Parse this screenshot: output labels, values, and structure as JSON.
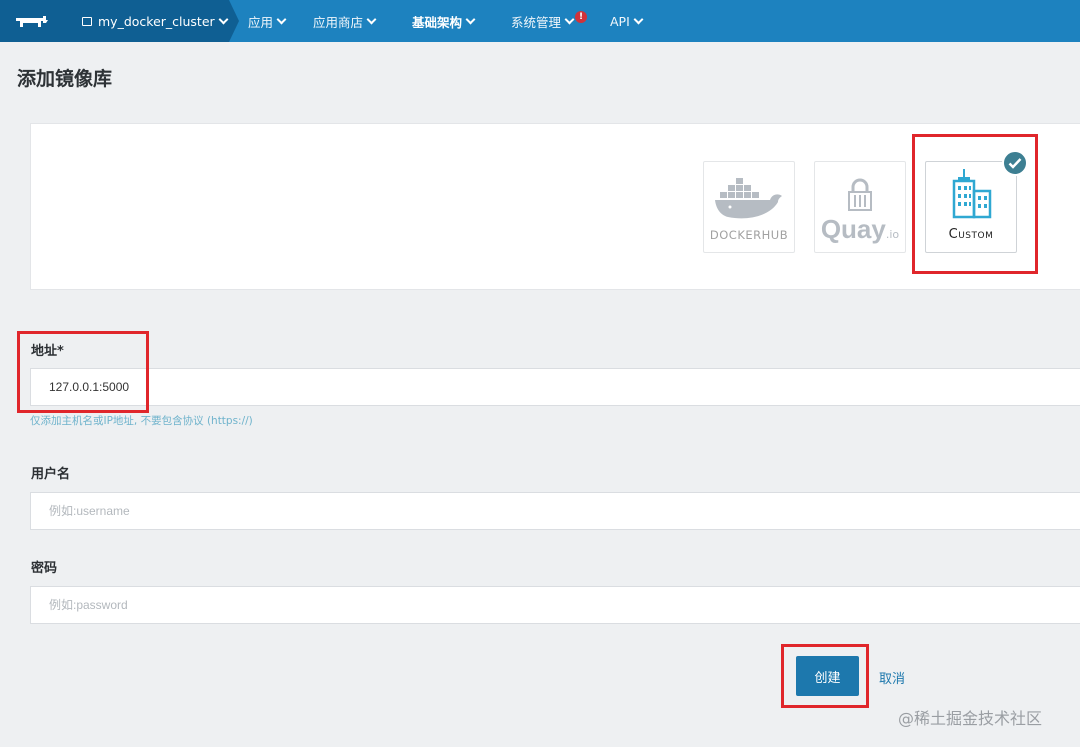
{
  "nav": {
    "environment": "my_docker_cluster",
    "items": [
      {
        "label": "应用",
        "has_dropdown": true
      },
      {
        "label": "应用商店",
        "has_dropdown": true
      },
      {
        "label": "基础架构",
        "has_dropdown": true,
        "active": true
      },
      {
        "label": "系统管理",
        "has_dropdown": true,
        "alert": "!"
      },
      {
        "label": "API",
        "has_dropdown": true
      }
    ]
  },
  "page": {
    "title": "添加镜像库"
  },
  "providers": [
    {
      "name": "DockerHub",
      "label": "DOCKERHUB",
      "selected": false
    },
    {
      "name": "Quay.io",
      "label": "Quay",
      "suffix": ".io",
      "selected": false
    },
    {
      "name": "Custom",
      "label": "Custom",
      "selected": true
    }
  ],
  "form": {
    "address": {
      "label": "地址*",
      "value": "127.0.0.1:5000",
      "help": "仅添加主机名或IP地址, 不要包含协议 (https://)"
    },
    "username": {
      "label": "用户名",
      "value": "",
      "placeholder": "例如:username"
    },
    "password": {
      "label": "密码",
      "value": "",
      "placeholder": "例如:password"
    }
  },
  "actions": {
    "create": "创建",
    "cancel": "取消"
  },
  "watermark": "@稀土掘金技术社区",
  "colors": {
    "nav": "#1d82bf",
    "nav_dark": "#0f5f93",
    "primary": "#1d78ad",
    "highlight_box": "#e0262b",
    "check_badge": "#3d7f92"
  }
}
